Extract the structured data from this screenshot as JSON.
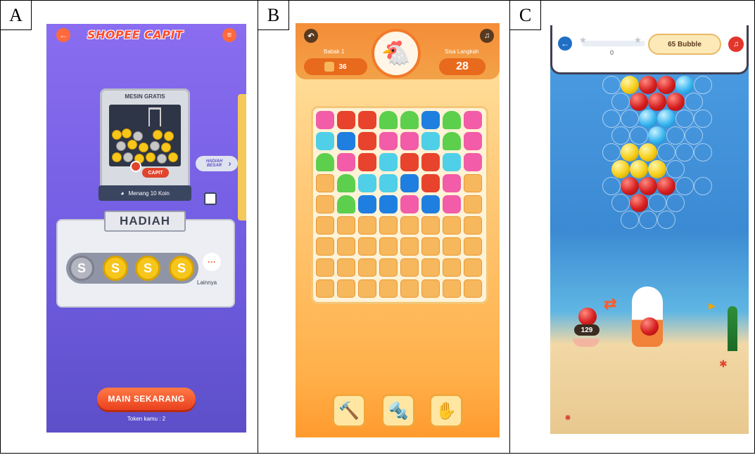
{
  "panels": [
    {
      "label": "A"
    },
    {
      "label": "B"
    },
    {
      "label": "C"
    }
  ],
  "panel_a": {
    "logo": "SHOPEE CAPIT",
    "machine_title": "MESIN GRATIS",
    "capit_button": "CAPIT",
    "hadiah_besar": "HADIAH BESAR",
    "win_text": "Menang 10 Koin",
    "hadiah_title": "HADIAH",
    "more_label": "Lainnya",
    "play_button": "MAIN SEKARANG",
    "token_text": "Token kamu : 2",
    "coin_symbol": "S"
  },
  "panel_b": {
    "round_label": "Babak 1",
    "round_value": "36",
    "moves_label": "Sisa Langkah",
    "moves_value": "28",
    "board_colors": {
      "pink": "#f25ca8",
      "red": "#e8432d",
      "green": "#5ccf4d",
      "blue": "#1f7fe0",
      "cyan": "#4fd0e8",
      "empty": "#f7b75c"
    }
  },
  "panel_c": {
    "score": "0",
    "bubble_count": "65 Bubble",
    "remaining": "129"
  }
}
